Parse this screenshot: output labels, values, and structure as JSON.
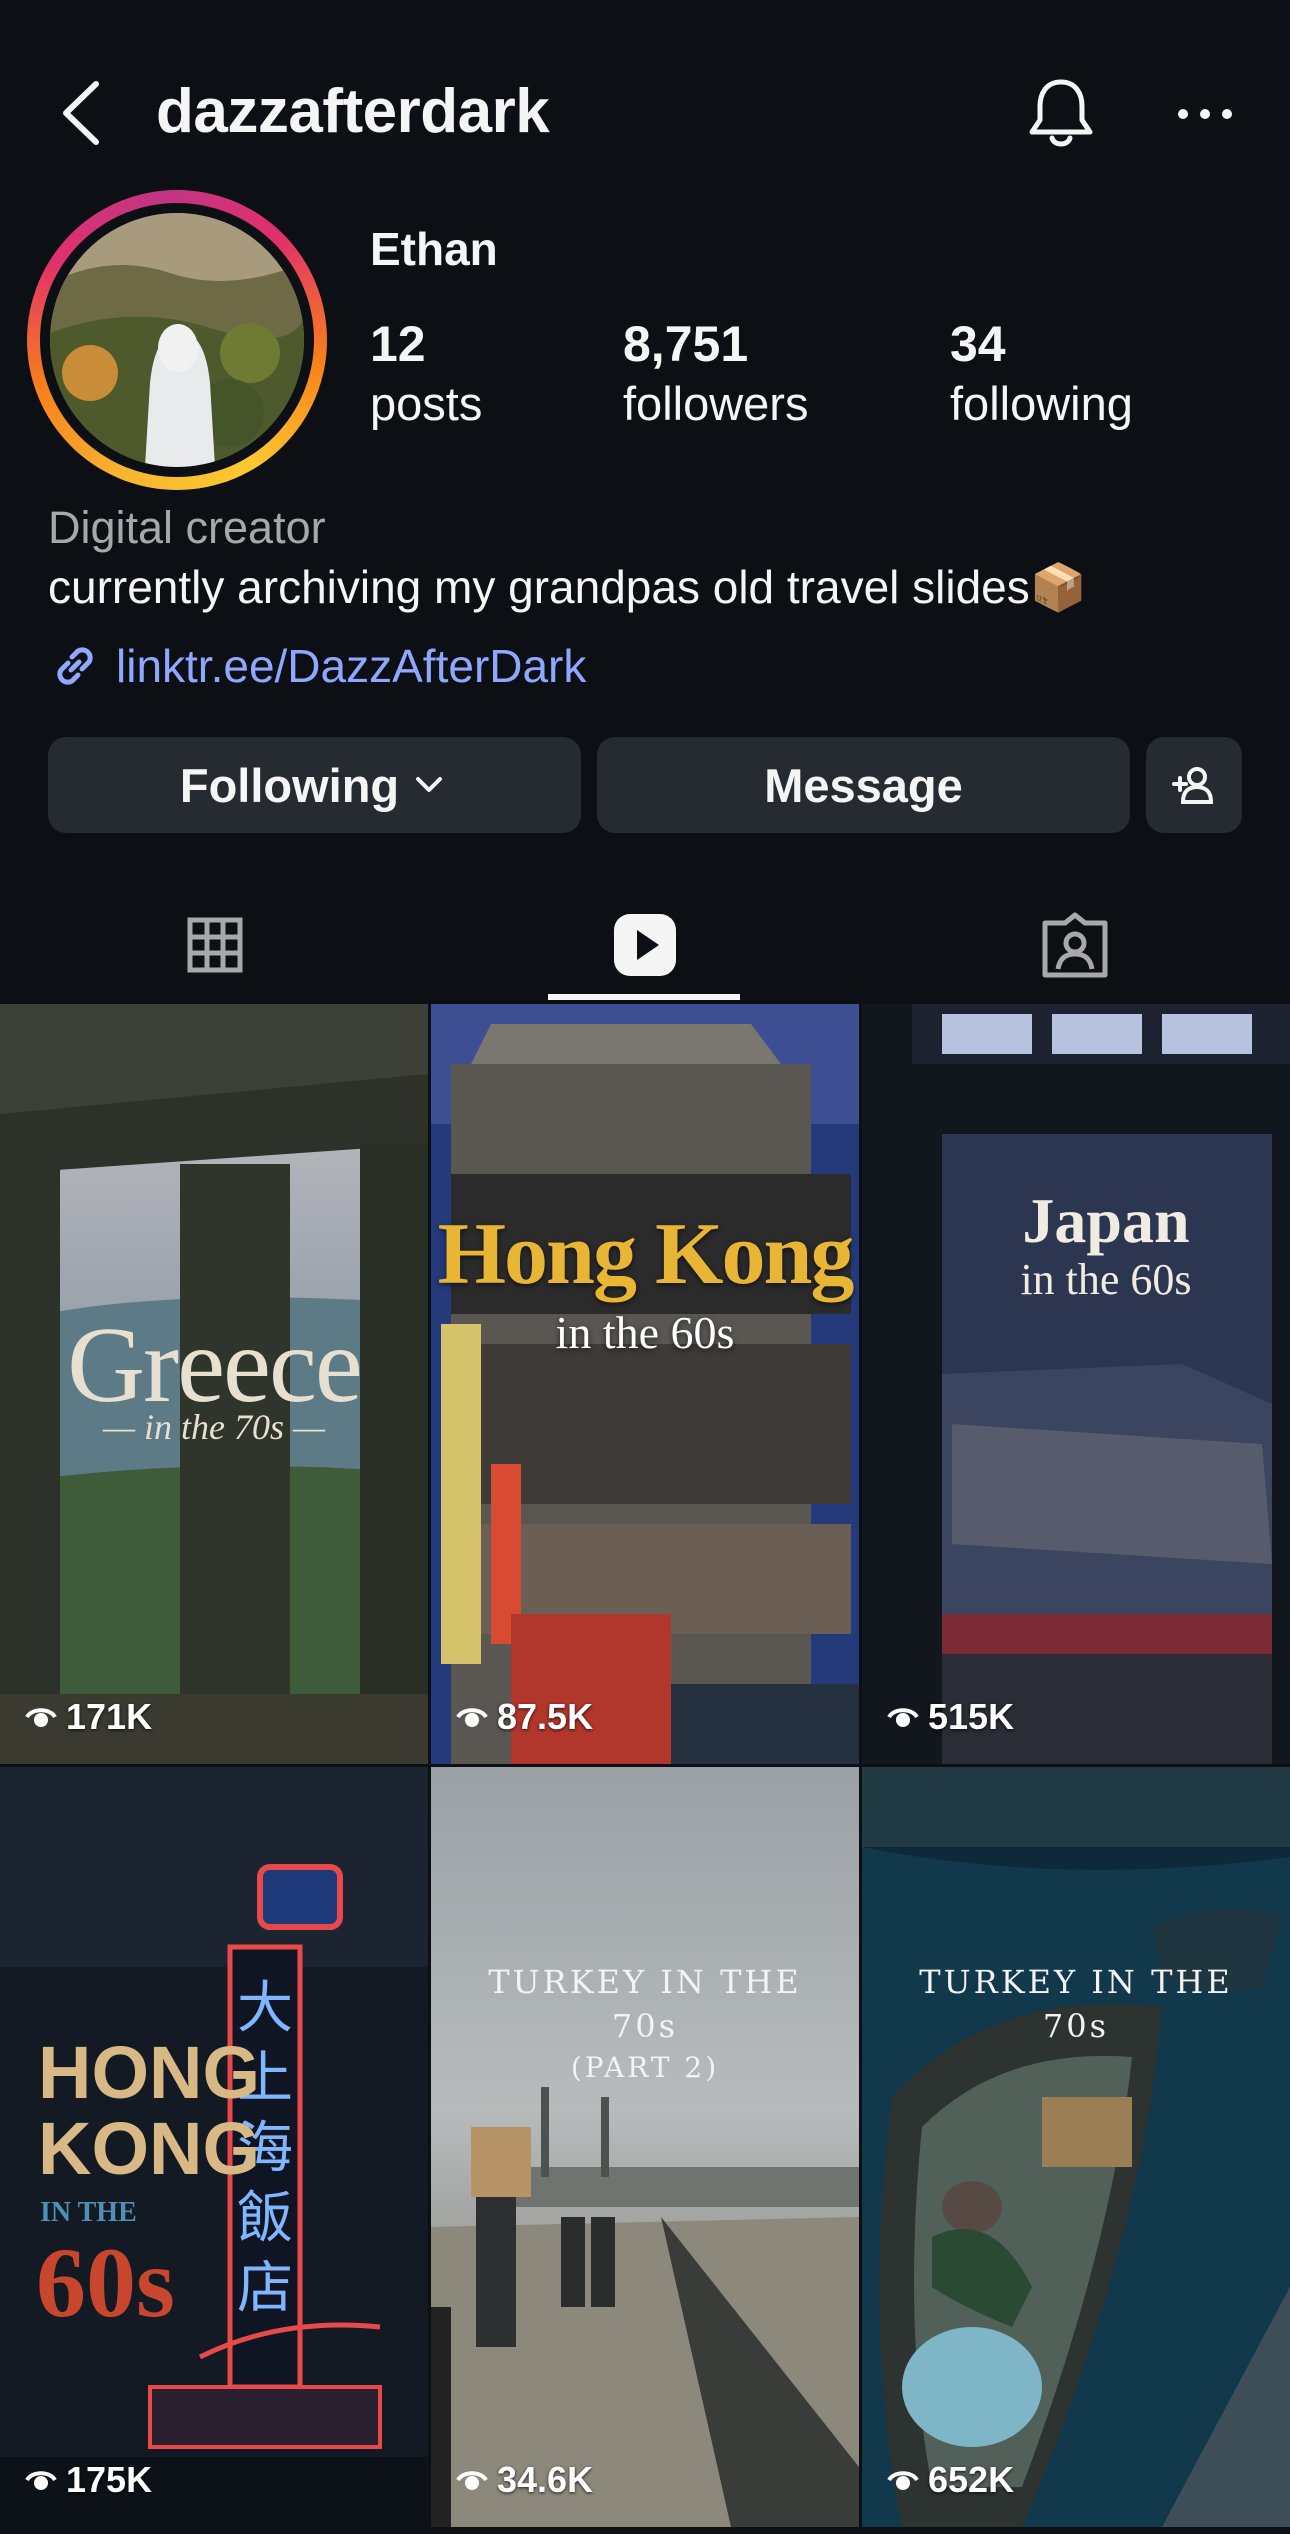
{
  "header": {
    "username": "dazzafterdark",
    "back_icon": "chevron-left-icon",
    "bell_icon": "bell-icon",
    "more_icon": "more-horizontal-icon"
  },
  "profile": {
    "display_name": "Ethan",
    "stats": [
      {
        "value": "12",
        "label": "posts"
      },
      {
        "value": "8,751",
        "label": "followers"
      },
      {
        "value": "34",
        "label": "following"
      }
    ],
    "category": "Digital creator",
    "bio": "currently archiving my grandpas old travel slides📦",
    "link": "linktr.ee/DazzAfterDark"
  },
  "actions": {
    "following_label": "Following",
    "message_label": "Message",
    "add_icon": "add-person-icon"
  },
  "tabs": [
    {
      "icon": "grid-icon"
    },
    {
      "icon": "reels-icon",
      "active": true
    },
    {
      "icon": "tagged-icon"
    }
  ],
  "reels": [
    {
      "title": "Greece",
      "subtitle": "— in the 70s —",
      "views": "171K"
    },
    {
      "title": "Hong Kong",
      "subtitle": "in the 60s",
      "views": "87.5K"
    },
    {
      "title": "Japan",
      "subtitle": "in the 60s",
      "views": "515K"
    },
    {
      "title": "HONG KONG",
      "title_line2": "IN THE",
      "title_line3": "60s",
      "views": "175K"
    },
    {
      "title": "TURKEY IN THE",
      "title_line2": "70s",
      "title_line3": "(PART 2)",
      "views": "34.6K"
    },
    {
      "title": "TURKEY IN THE",
      "title_line2": "70s",
      "views": "652K"
    }
  ],
  "colors": {
    "background": "#0c1014",
    "button": "#262a31",
    "link": "#8fa7ff",
    "hk_title": "#e8b535"
  }
}
